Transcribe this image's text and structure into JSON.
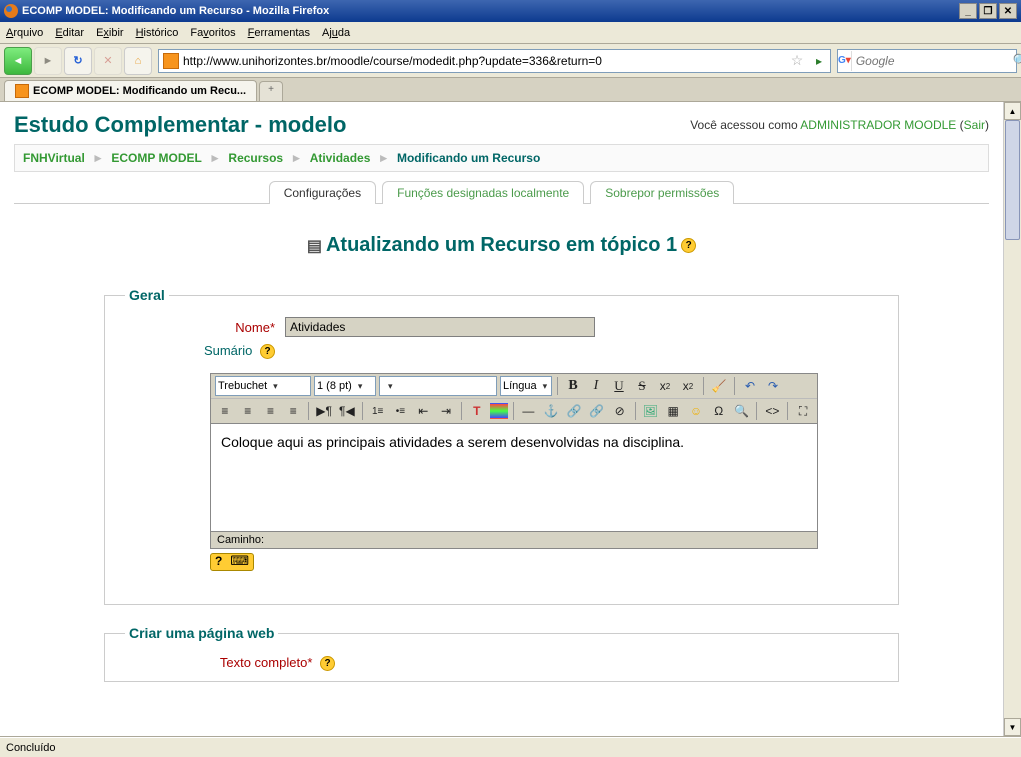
{
  "window": {
    "title": "ECOMP MODEL: Modificando um Recurso - Mozilla Firefox"
  },
  "menu": [
    "Arquivo",
    "Editar",
    "Exibir",
    "Histórico",
    "Favoritos",
    "Ferramentas",
    "Ajuda"
  ],
  "url": "http://www.unihorizontes.br/moodle/course/modedit.php?update=336&return=0",
  "search_placeholder": "Google",
  "browser_tab": "ECOMP MODEL: Modificando um Recu...",
  "moodle": {
    "title": "Estudo Complementar - modelo",
    "loggedin_prefix": "Você acessou como ",
    "loggedin_user": "ADMINISTRADOR MOODLE",
    "logout_open": " (",
    "logout_label": "Sair",
    "logout_close": ")",
    "breadcrumb": [
      "FNHVirtual",
      "ECOMP MODEL",
      "Recursos",
      "Atividades"
    ],
    "breadcrumb_current": "Modificando um Recurso",
    "tabs": [
      "Configurações",
      "Funções designadas localmente",
      "Sobrepor permissões"
    ],
    "heading": "Atualizando um Recurso em tópico 1",
    "fieldset_geral": "Geral",
    "label_nome": "Nome",
    "nome_value": "Atividades",
    "label_sumario": "Sumário",
    "editor": {
      "font": "Trebuchet",
      "size": "1 (8 pt)",
      "heading": "",
      "lang": "Língua",
      "content": "Coloque aqui as principais atividades a serem desenvolvidas na disciplina.",
      "path_label": "Caminho:"
    },
    "fieldset_criar": "Criar uma página web",
    "label_texto": "Texto completo"
  },
  "status": "Concluído"
}
